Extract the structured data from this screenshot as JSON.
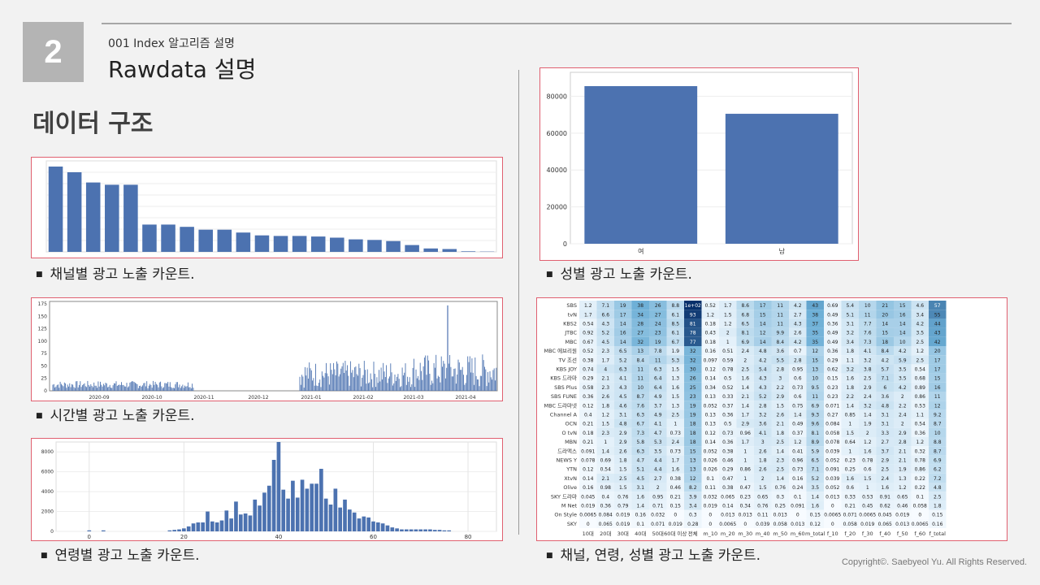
{
  "slide": {
    "number": "2",
    "subtitle": "001 Index 알고리즘 설명",
    "title": "Rawdata 설명",
    "heading": "데이터 구조",
    "copyright": "Copyright©. Saebyeol Yu. All Rights Reserved."
  },
  "captions": {
    "channel": "채널별 광고 노출 카운트.",
    "time": "시간별 광고 노출 카운트.",
    "age": "연령별 광고 노출 카운트.",
    "gender": "성별 광고 노출 카운트.",
    "heatmap": "채널, 연령, 성별 광고 노출 카운트."
  },
  "colors": {
    "bar": "#4c72b0",
    "panel_border": "#e06070",
    "section_box": "#b4b4b4"
  },
  "chart_data": [
    {
      "type": "bar",
      "id": "channel",
      "values": [
        150000,
        140000,
        122000,
        118000,
        118000,
        48000,
        48000,
        44000,
        39000,
        39000,
        34000,
        29000,
        28000,
        28000,
        27000,
        25000,
        22000,
        21000,
        19000,
        12000,
        6000,
        5000,
        1000,
        500
      ],
      "ylim": [
        0,
        160000
      ]
    },
    {
      "type": "bar",
      "id": "time",
      "x_tick_labels": [
        "2020-09",
        "2020-10",
        "2020-11",
        "2020-12",
        "2021-01",
        "2021-02",
        "2021-03",
        "2021-04"
      ],
      "y_tick_labels": [
        "0",
        "25",
        "50",
        "75",
        "100",
        "125",
        "150",
        "175"
      ],
      "ylim": [
        0,
        180
      ],
      "annotated_peak": 172
    },
    {
      "type": "bar",
      "id": "age",
      "x_tick_labels": [
        "0",
        "20",
        "40",
        "60",
        "80"
      ],
      "y_tick_labels": [
        "0",
        "2000",
        "4000",
        "6000",
        "8000"
      ],
      "xlim": [
        -7,
        86
      ],
      "ylim": [
        0,
        9000
      ],
      "x": [
        0,
        3,
        17,
        18,
        19,
        20,
        21,
        22,
        23,
        24,
        25,
        26,
        27,
        28,
        29,
        30,
        31,
        32,
        33,
        34,
        35,
        36,
        37,
        38,
        39,
        40,
        41,
        42,
        43,
        44,
        45,
        46,
        47,
        48,
        49,
        50,
        51,
        52,
        53,
        54,
        55,
        56,
        57,
        58,
        59,
        60,
        61,
        62,
        63,
        64,
        65,
        66,
        67,
        68,
        69,
        70,
        71,
        72,
        73,
        74,
        75,
        76
      ],
      "values": [
        100,
        100,
        100,
        150,
        200,
        300,
        500,
        800,
        900,
        900,
        2000,
        1000,
        900,
        1100,
        2100,
        1300,
        3000,
        1700,
        1800,
        1600,
        3200,
        2600,
        3900,
        4600,
        7200,
        9000,
        4200,
        3300,
        5100,
        3400,
        5200,
        4300,
        4800,
        4800,
        6300,
        3300,
        2700,
        4300,
        2400,
        3200,
        2200,
        1900,
        1300,
        1500,
        1400,
        1000,
        900,
        800,
        600,
        400,
        300,
        200,
        200,
        200,
        200,
        200,
        200,
        200,
        150,
        150,
        100,
        100
      ]
    },
    {
      "type": "bar",
      "id": "gender",
      "categories": [
        "여",
        "남"
      ],
      "values": [
        85500,
        70500
      ],
      "y_tick_labels": [
        "0",
        "20000",
        "40000",
        "60000",
        "80000"
      ],
      "ylim": [
        0,
        93000
      ]
    },
    {
      "type": "heatmap",
      "id": "heatmap",
      "rows": [
        "SBS",
        "tvN",
        "KBS2",
        "JTBC",
        "MBC",
        "MBC 에브리원",
        "TV 조선",
        "KBS JOY",
        "KBS 드라마",
        "SBS Plus",
        "SBS FUNE",
        "MBC 드라마넷",
        "Channel A",
        "OCN",
        "O tvN",
        "MBN",
        "드라맥스",
        "NEWS Y",
        "YTN",
        "XtvN",
        "Olive",
        "SKY 드라마",
        "M Net",
        "On Style",
        "SKY"
      ],
      "columns": [
        "10대",
        "20대",
        "30대",
        "40대",
        "50대",
        "60대 이상",
        "전체",
        "m_10",
        "m_20",
        "m_30",
        "m_40",
        "m_50",
        "m_60",
        "m_total",
        "f_10",
        "f_20",
        "f_30",
        "f_40",
        "f_50",
        "f_60",
        "f_total"
      ],
      "values": [
        [
          "1.2",
          "7.1",
          "19",
          "38",
          "26",
          "8.8",
          "1e+02",
          "0.52",
          "1.7",
          "8.6",
          "17",
          "11",
          "4.2",
          "43",
          "0.69",
          "5.4",
          "10",
          "21",
          "15",
          "4.6",
          "57"
        ],
        [
          "1.7",
          "6.6",
          "17",
          "34",
          "27",
          "6.1",
          "93",
          "1.2",
          "1.5",
          "6.8",
          "15",
          "11",
          "2.7",
          "38",
          "0.49",
          "5.1",
          "11",
          "20",
          "16",
          "3.4",
          "55"
        ],
        [
          "0.54",
          "4.3",
          "14",
          "28",
          "24",
          "8.5",
          "81",
          "0.18",
          "1.2",
          "6.5",
          "14",
          "11",
          "4.3",
          "37",
          "0.36",
          "3.1",
          "7.7",
          "14",
          "14",
          "4.2",
          "44"
        ],
        [
          "0.92",
          "5.2",
          "16",
          "27",
          "23",
          "6.1",
          "78",
          "0.43",
          "2",
          "8.1",
          "12",
          "9.9",
          "2.6",
          "35",
          "0.49",
          "3.2",
          "7.6",
          "15",
          "14",
          "3.5",
          "43"
        ],
        [
          "0.67",
          "4.5",
          "14",
          "32",
          "19",
          "6.7",
          "77",
          "0.18",
          "1",
          "6.9",
          "14",
          "8.4",
          "4.2",
          "35",
          "0.49",
          "3.4",
          "7.3",
          "18",
          "10",
          "2.5",
          "42"
        ],
        [
          "0.52",
          "2.3",
          "6.5",
          "13",
          "7.8",
          "1.9",
          "32",
          "0.16",
          "0.51",
          "2.4",
          "4.8",
          "3.6",
          "0.7",
          "12",
          "0.36",
          "1.8",
          "4.1",
          "8.4",
          "4.2",
          "1.2",
          "20"
        ],
        [
          "0.38",
          "1.7",
          "5.2",
          "8.4",
          "11",
          "5.3",
          "32",
          "0.097",
          "0.59",
          "2",
          "4.2",
          "5.5",
          "2.8",
          "15",
          "0.29",
          "1.1",
          "3.2",
          "4.2",
          "5.9",
          "2.5",
          "17"
        ],
        [
          "0.74",
          "4",
          "6.3",
          "11",
          "6.3",
          "1.5",
          "30",
          "0.12",
          "0.78",
          "2.5",
          "5.4",
          "2.8",
          "0.95",
          "13",
          "0.62",
          "3.2",
          "3.8",
          "5.7",
          "3.5",
          "0.54",
          "17"
        ],
        [
          "0.29",
          "2.1",
          "4.1",
          "11",
          "6.4",
          "1.3",
          "26",
          "0.14",
          "0.5",
          "1.6",
          "4.3",
          "3",
          "0.6",
          "10",
          "0.15",
          "1.6",
          "2.5",
          "7.1",
          "3.5",
          "0.68",
          "15"
        ],
        [
          "0.58",
          "2.3",
          "4.3",
          "10",
          "6.4",
          "1.6",
          "25",
          "0.34",
          "0.52",
          "1.4",
          "4.3",
          "2.2",
          "0.73",
          "9.5",
          "0.23",
          "1.8",
          "2.9",
          "6",
          "4.2",
          "0.89",
          "16"
        ],
        [
          "0.36",
          "2.6",
          "4.5",
          "8.7",
          "4.9",
          "1.5",
          "23",
          "0.13",
          "0.33",
          "2.1",
          "5.2",
          "2.9",
          "0.6",
          "11",
          "0.23",
          "2.2",
          "2.4",
          "3.6",
          "2",
          "0.86",
          "11"
        ],
        [
          "0.12",
          "1.8",
          "4.6",
          "7.6",
          "3.7",
          "1.3",
          "19",
          "0.052",
          "0.37",
          "1.4",
          "2.8",
          "1.5",
          "0.75",
          "6.9",
          "0.071",
          "1.4",
          "3.2",
          "4.8",
          "2.2",
          "0.53",
          "12"
        ],
        [
          "0.4",
          "1.2",
          "3.1",
          "6.3",
          "4.9",
          "2.5",
          "19",
          "0.13",
          "0.36",
          "1.7",
          "3.2",
          "2.6",
          "1.4",
          "9.3",
          "0.27",
          "0.85",
          "1.4",
          "3.1",
          "2.4",
          "1.1",
          "9.2"
        ],
        [
          "0.21",
          "1.5",
          "4.8",
          "6.7",
          "4.1",
          "1",
          "18",
          "0.13",
          "0.5",
          "2.9",
          "3.6",
          "2.1",
          "0.49",
          "9.6",
          "0.084",
          "1",
          "1.9",
          "3.1",
          "2",
          "0.54",
          "8.7"
        ],
        [
          "0.18",
          "2.3",
          "2.9",
          "7.3",
          "4.7",
          "0.73",
          "18",
          "0.12",
          "0.73",
          "0.96",
          "4.1",
          "1.8",
          "0.37",
          "8.1",
          "0.058",
          "1.5",
          "2",
          "3.3",
          "2.9",
          "0.36",
          "10"
        ],
        [
          "0.21",
          "1",
          "2.9",
          "5.8",
          "5.3",
          "2.4",
          "18",
          "0.14",
          "0.36",
          "1.7",
          "3",
          "2.5",
          "1.2",
          "8.9",
          "0.078",
          "0.64",
          "1.2",
          "2.7",
          "2.8",
          "1.2",
          "8.8"
        ],
        [
          "0.091",
          "1.4",
          "2.6",
          "6.3",
          "3.5",
          "0.73",
          "15",
          "0.052",
          "0.38",
          "1",
          "2.6",
          "1.4",
          "0.41",
          "5.9",
          "0.039",
          "1",
          "1.6",
          "3.7",
          "2.1",
          "0.32",
          "8.7"
        ],
        [
          "0.078",
          "0.69",
          "1.8",
          "4.7",
          "4.4",
          "1.7",
          "13",
          "0.026",
          "0.46",
          "1",
          "1.8",
          "2.3",
          "0.96",
          "6.5",
          "0.052",
          "0.23",
          "0.78",
          "2.9",
          "2.1",
          "0.78",
          "6.9"
        ],
        [
          "0.12",
          "0.54",
          "1.5",
          "5.1",
          "4.4",
          "1.6",
          "13",
          "0.026",
          "0.29",
          "0.86",
          "2.6",
          "2.5",
          "0.73",
          "7.1",
          "0.091",
          "0.25",
          "0.6",
          "2.5",
          "1.9",
          "0.86",
          "6.2"
        ],
        [
          "0.14",
          "2.1",
          "2.5",
          "4.5",
          "2.7",
          "0.38",
          "12",
          "0.1",
          "0.47",
          "1",
          "2",
          "1.4",
          "0.16",
          "5.2",
          "0.039",
          "1.6",
          "1.5",
          "2.4",
          "1.3",
          "0.22",
          "7.2"
        ],
        [
          "0.16",
          "0.98",
          "1.5",
          "3.1",
          "2",
          "0.46",
          "8.2",
          "0.11",
          "0.38",
          "0.47",
          "1.5",
          "0.76",
          "0.24",
          "3.5",
          "0.052",
          "0.6",
          "1",
          "1.6",
          "1.2",
          "0.22",
          "4.8"
        ],
        [
          "0.045",
          "0.4",
          "0.76",
          "1.6",
          "0.95",
          "0.21",
          "3.9",
          "0.032",
          "0.065",
          "0.23",
          "0.65",
          "0.3",
          "0.1",
          "1.4",
          "0.013",
          "0.33",
          "0.53",
          "0.91",
          "0.65",
          "0.1",
          "2.5"
        ],
        [
          "0.019",
          "0.36",
          "0.79",
          "1.4",
          "0.71",
          "0.15",
          "3.4",
          "0.019",
          "0.14",
          "0.34",
          "0.76",
          "0.25",
          "0.091",
          "1.6",
          "0",
          "0.21",
          "0.45",
          "0.62",
          "0.46",
          "0.058",
          "1.8"
        ],
        [
          "0.0065",
          "0.084",
          "0.019",
          "0.16",
          "0.032",
          "0",
          "0.3",
          "0",
          "0.013",
          "0.013",
          "0.11",
          "0.013",
          "0",
          "0.15",
          "0.0065",
          "0.071",
          "0.0065",
          "0.045",
          "0.019",
          "0",
          "0.15"
        ],
        [
          "0",
          "0.065",
          "0.019",
          "0.1",
          "0.071",
          "0.019",
          "0.28",
          "0",
          "0.0065",
          "0",
          "0.039",
          "0.058",
          "0.013",
          "0.12",
          "0",
          "0.058",
          "0.019",
          "0.065",
          "0.013",
          "0.0065",
          "0.16"
        ]
      ]
    }
  ]
}
